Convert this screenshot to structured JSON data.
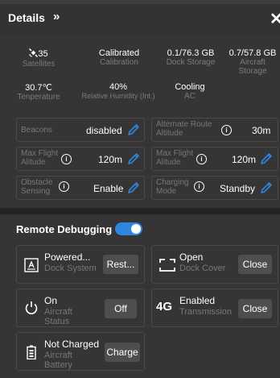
{
  "header": {
    "title": "Details",
    "chevron": "»",
    "close": "✕"
  },
  "stats": [
    {
      "value": "35",
      "label": "Satellites",
      "icon": "satellite-icon"
    },
    {
      "value": "Calibrated",
      "label": "Calibration"
    },
    {
      "value": "0.1/76.3 GB",
      "label": "Dock Storage"
    },
    {
      "value": "0.7/57.8 GB",
      "label": "Aircraft Storage"
    },
    {
      "value": "30.7℃",
      "label": "Tenperature"
    },
    {
      "value": "40%",
      "label": "Relative Humidity (Int.)"
    },
    {
      "value": "Cooling",
      "label": "AC"
    }
  ],
  "settings": {
    "beacons": {
      "label": "Beacons",
      "value": "disabled"
    },
    "alternate_route_altitude": {
      "label": "Alternate Route Altitude",
      "value": "30m"
    },
    "max_flight_alitude_left": {
      "label": "Max Flight Alitude",
      "value": "120m"
    },
    "max_flight_alitude_right": {
      "label": "Max Flight Alitude",
      "value": "120m"
    },
    "obstacle_sensing": {
      "label": "Obstacle Sensing",
      "value": "Enable"
    },
    "charging_mode": {
      "label": "Charging Mode",
      "value": "Standby"
    }
  },
  "remote_debugging": {
    "title": "Remote Debugging",
    "enabled": true,
    "accent": "#2e86de",
    "cards": {
      "dock_system": {
        "title": "Powered...",
        "subtitle": "Dock System",
        "button": "Rest..."
      },
      "dock_cover": {
        "title": "Open",
        "subtitle": "Dock Cover",
        "button": "Close"
      },
      "aircraft_status": {
        "title": "On",
        "subtitle": "Aircraft Status",
        "button": "Off"
      },
      "transmission": {
        "title": "Enabled",
        "subtitle": "Transmission",
        "button": "Close",
        "icon_text": "4G"
      },
      "aircraft_battery": {
        "title": "Not Charged",
        "subtitle": "Aircraft Battery",
        "button": "Charge"
      }
    }
  }
}
